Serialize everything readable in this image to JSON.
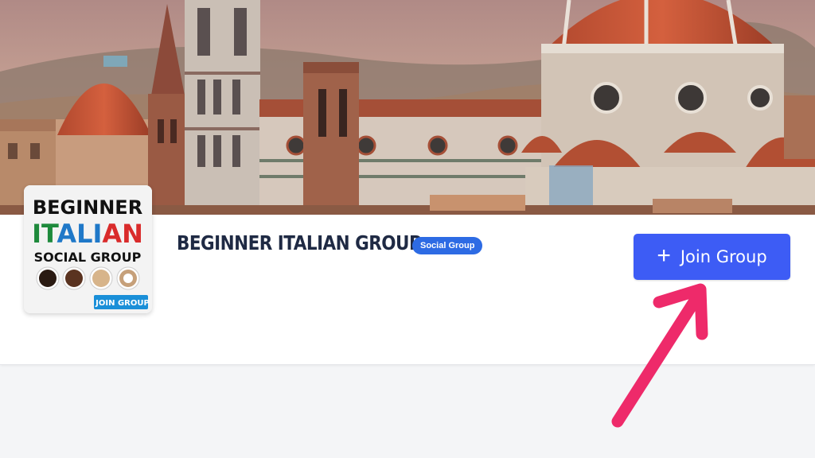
{
  "group": {
    "title": "BEGINNER ITALIAN GROUP",
    "badge": "Social Group"
  },
  "join_button": {
    "icon": "plus-icon",
    "icon_glyph": "+",
    "label": "Join Group"
  },
  "avatar": {
    "line1": "BEGINNER",
    "line2_it": "IT",
    "line2_ali": "ALI",
    "line2_an": "AN",
    "line3": "SOCIAL GROUP",
    "join_tag": "JOIN GROUP"
  },
  "colors": {
    "accent_button": "#3d5cf5",
    "badge": "#2d6be4",
    "annotation_arrow": "#ee2a6a",
    "italian_green": "#1e8a3c",
    "italian_red": "#d92b2b"
  },
  "cover": {
    "image": "florence-cathedral-skyline"
  },
  "annotation": {
    "icon": "arrow-annotation-icon"
  }
}
